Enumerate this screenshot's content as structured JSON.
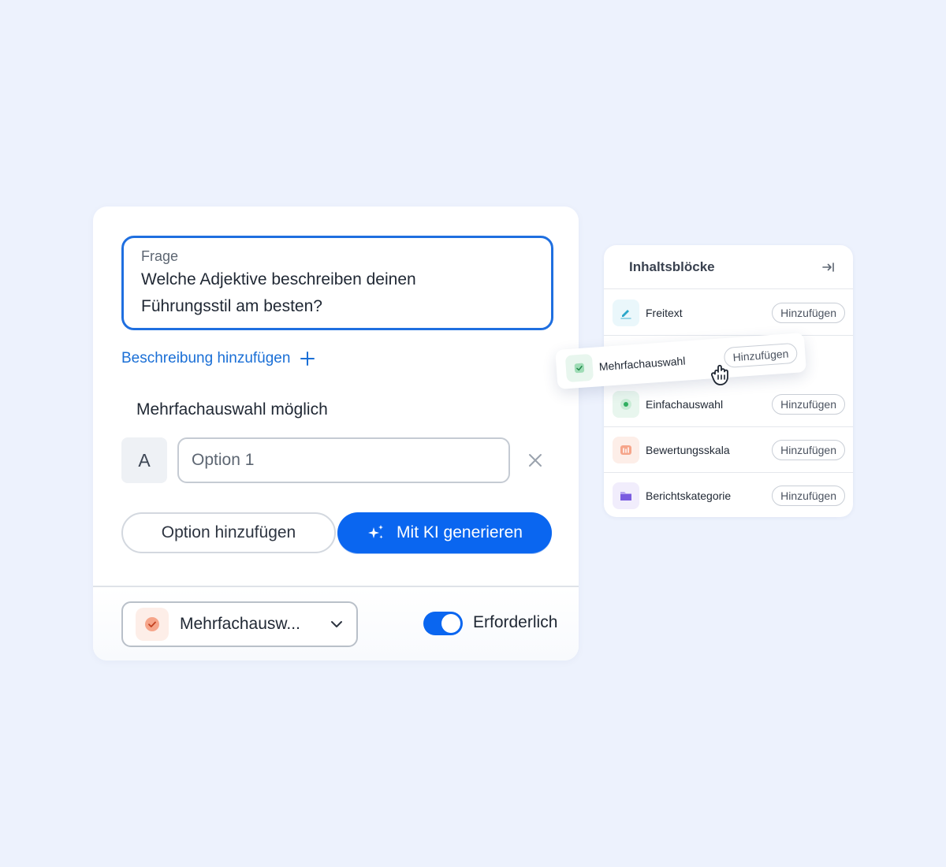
{
  "question_card": {
    "question_label": "Frage",
    "question_line1": "Welche Adjektive beschreiben deinen",
    "question_line2": "Führungsstil am besten?",
    "add_description": "Beschreibung hinzufügen",
    "multi_select_label": "Mehrfachauswahl möglich",
    "option_letter": "A",
    "option_placeholder": "Option 1",
    "add_option_button": "Option hinzufügen",
    "ai_button": "Mit KI generieren",
    "type_select_value": "Mehrfachausw...",
    "required_label": "Erforderlich",
    "required_on": true
  },
  "blocks_panel": {
    "title": "Inhaltsblöcke",
    "add_label": "Hinzufügen",
    "items": [
      {
        "label": "Freitext",
        "icon": "pen-icon",
        "color": "#2aa7c9",
        "bg": "#eaf7fb"
      },
      {
        "label": "Einfachauswahl",
        "icon": "radio-icon",
        "color": "#2fae5f",
        "bg": "#e8f6ee"
      },
      {
        "label": "Bewertungsskala",
        "icon": "scale-icon",
        "color": "#ef7a5a",
        "bg": "#fdeee8"
      },
      {
        "label": "Berichtskategorie",
        "icon": "folder-icon",
        "color": "#7a5ce0",
        "bg": "#f1edfc"
      }
    ],
    "dragged_item": {
      "label": "Mehrfachauswahl",
      "icon": "checkbox-icon",
      "color": "#2fae5f",
      "bg": "#e8f6ee"
    }
  },
  "colors": {
    "accent": "#0a66f0",
    "link": "#1a6fd6",
    "background": "#edf2fd"
  }
}
